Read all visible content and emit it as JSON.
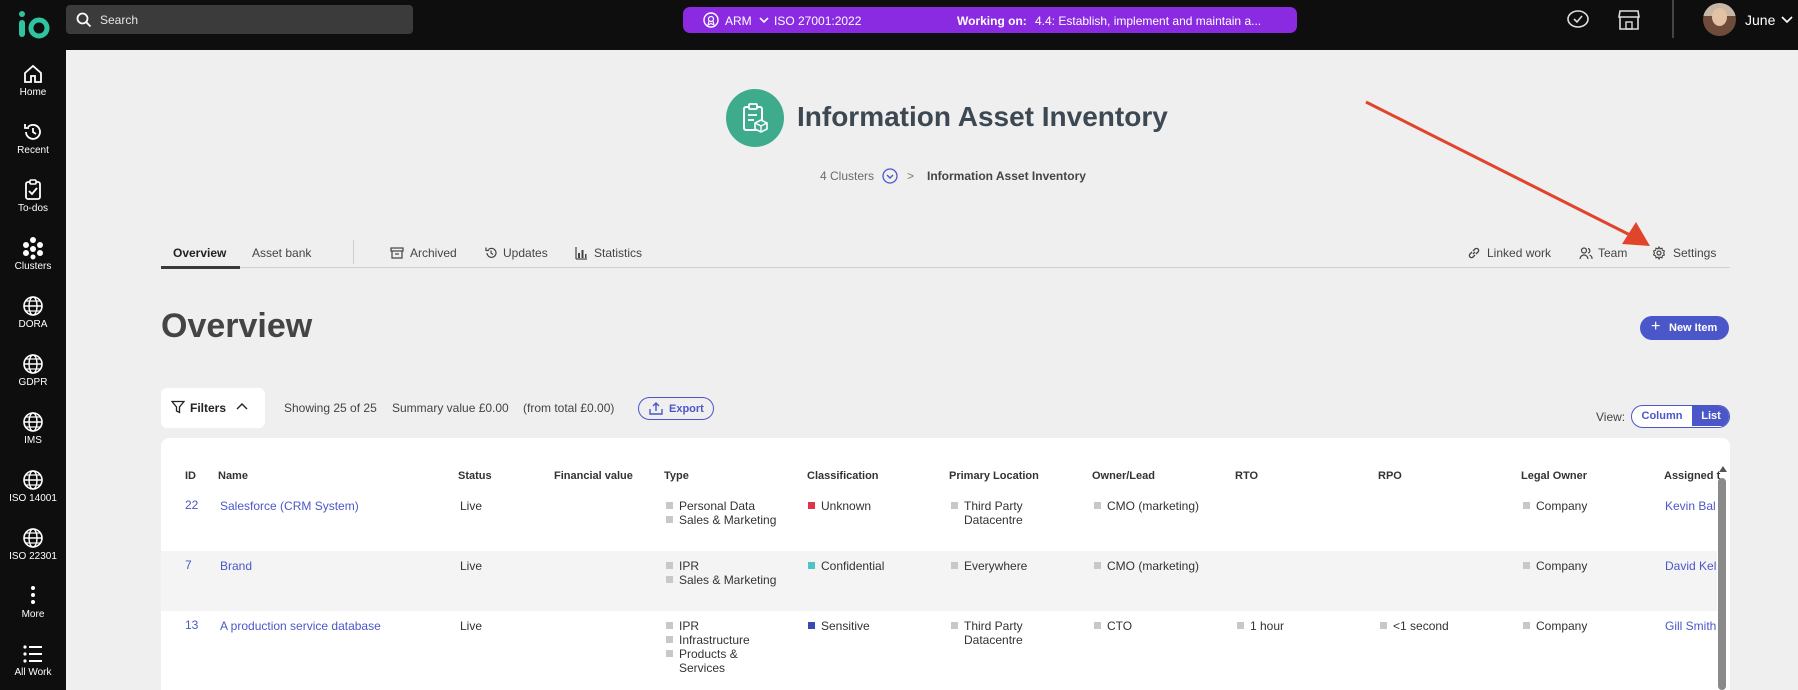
{
  "topbar": {
    "logo_text": "io",
    "search_placeholder": "Search",
    "framework": "ARM",
    "standard": "ISO 27001:2022",
    "working_on_label": "Working on:",
    "working_on_item": "4.4: Establish, implement and maintain a...",
    "user_name": "June"
  },
  "sidebar": {
    "items": [
      {
        "label": "Home",
        "icon": "home-icon"
      },
      {
        "label": "Recent",
        "icon": "history-icon"
      },
      {
        "label": "To-dos",
        "icon": "clipboard-icon"
      },
      {
        "label": "Clusters",
        "icon": "clusters-icon"
      },
      {
        "label": "DORA",
        "icon": "globe-icon"
      },
      {
        "label": "GDPR",
        "icon": "globe-icon"
      },
      {
        "label": "IMS",
        "icon": "globe-icon"
      },
      {
        "label": "ISO 14001",
        "icon": "globe-icon"
      },
      {
        "label": "ISO 22301",
        "icon": "globe-icon"
      },
      {
        "label": "More",
        "icon": "more-icon"
      },
      {
        "label": "All Work",
        "icon": "list-icon"
      }
    ]
  },
  "header": {
    "title": "Information Asset Inventory",
    "breadcrumb_clusters": "4 Clusters",
    "breadcrumb_separator": ">",
    "breadcrumb_current": "Information Asset Inventory"
  },
  "tabs": {
    "overview": "Overview",
    "asset_bank": "Asset bank",
    "archived": "Archived",
    "updates": "Updates",
    "statistics": "Statistics",
    "linked_work": "Linked work",
    "team": "Team",
    "settings": "Settings"
  },
  "main": {
    "title": "Overview",
    "new_item": "New Item",
    "filters": "Filters",
    "showing": "Showing 25 of 25",
    "summary": "Summary value £0.00",
    "total": "(from total £0.00)",
    "export": "Export",
    "view_label": "View:",
    "view_column": "Column",
    "view_list": "List"
  },
  "table": {
    "headers": [
      "ID",
      "Name",
      "Status",
      "Financial value",
      "Type",
      "Classification",
      "Primary Location",
      "Owner/Lead",
      "RTO",
      "RPO",
      "Legal Owner",
      "Assigned t"
    ],
    "rows": [
      {
        "id": "22",
        "name": "Salesforce (CRM System)",
        "status": "Live",
        "financial": "",
        "type": [
          "Personal Data",
          "Sales & Marketing"
        ],
        "classification": "Unknown",
        "class_color": "#e0344a",
        "location": [
          "Third Party",
          "Datacentre"
        ],
        "owner": "CMO (marketing)",
        "rto": "",
        "rpo": "",
        "legal": "Company",
        "assigned": "Kevin Bal"
      },
      {
        "id": "7",
        "name": "Brand",
        "status": "Live",
        "financial": "",
        "type": [
          "IPR",
          "Sales & Marketing"
        ],
        "classification": "Confidential",
        "class_color": "#4fc4c4",
        "location": [
          "Everywhere"
        ],
        "owner": "CMO (marketing)",
        "rto": "",
        "rpo": "",
        "legal": "Company",
        "assigned": "David Kel"
      },
      {
        "id": "13",
        "name": "A production service database",
        "status": "Live",
        "financial": "",
        "type": [
          "IPR",
          "Infrastructure",
          "Products &",
          "Services"
        ],
        "classification": "Sensitive",
        "class_color": "#3b48b8",
        "location": [
          "Third Party",
          "Datacentre"
        ],
        "owner": "CTO",
        "rto": "1 hour",
        "rpo": "<1 second",
        "legal": "Company",
        "assigned": "Gill Smith"
      }
    ]
  },
  "colors": {
    "accent": "#4b57c9",
    "pill": "#8a2be2",
    "header_icon": "#3eab8d",
    "annotation_arrow": "#e0452b"
  }
}
